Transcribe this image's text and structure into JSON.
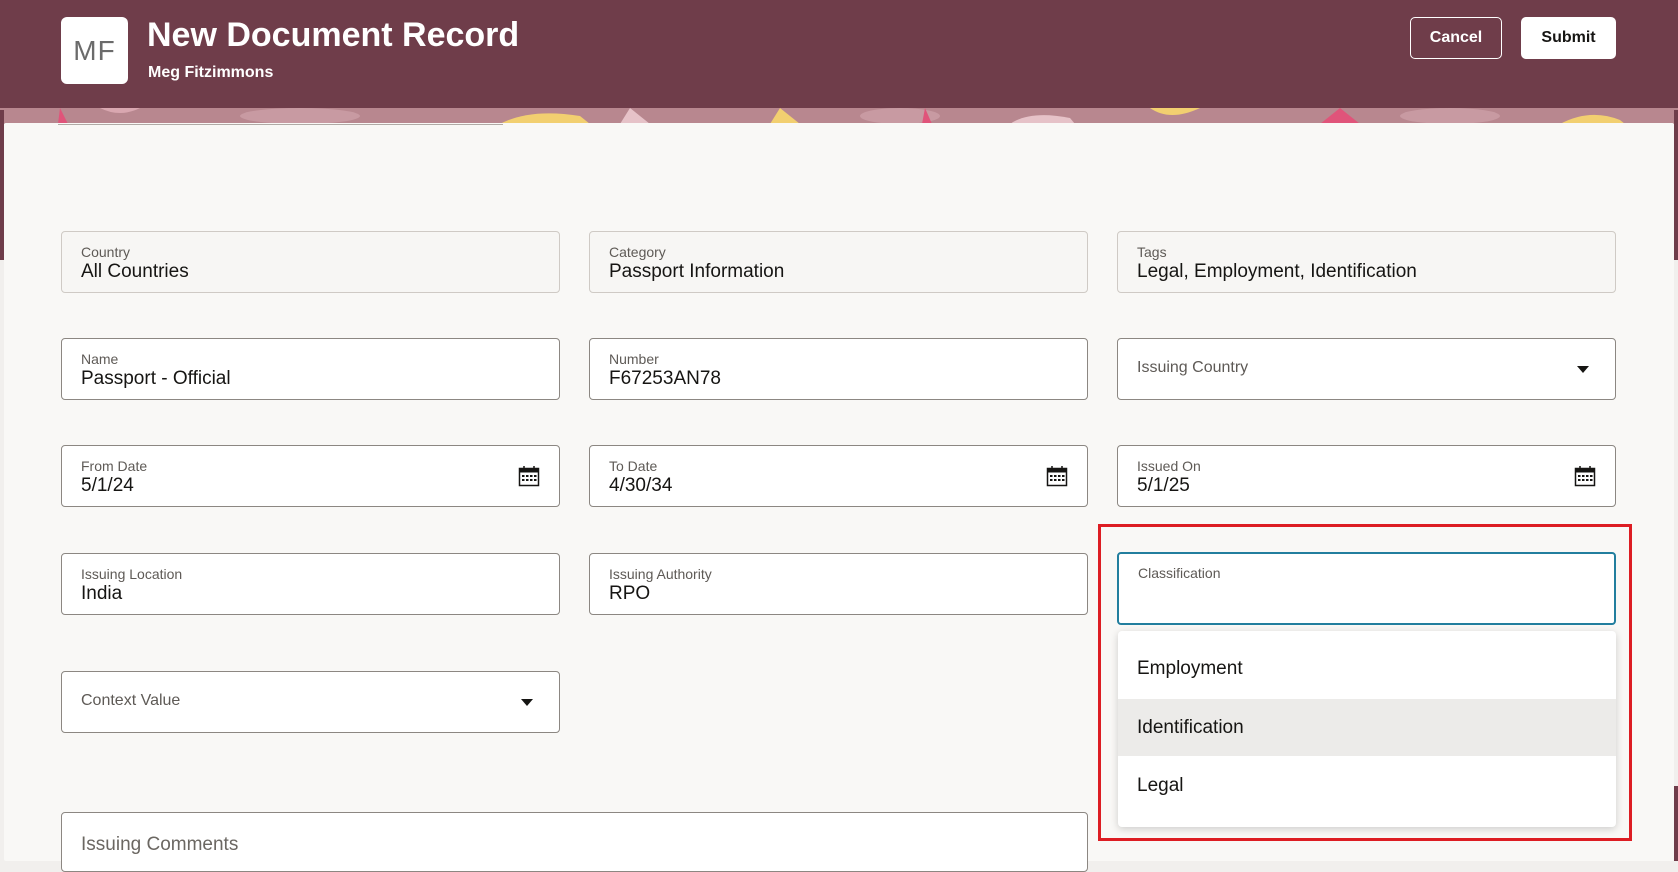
{
  "header": {
    "avatar_initials": "MF",
    "title": "New Document Record",
    "subtitle": "Meg Fitzimmons",
    "cancel_label": "Cancel",
    "submit_label": "Submit"
  },
  "colors": {
    "brand": "#6f3d4a",
    "focus": "#227e9e",
    "highlight_box": "#dd1d23"
  },
  "form": {
    "country": {
      "label": "Country",
      "value": "All Countries"
    },
    "category": {
      "label": "Category",
      "value": "Passport Information"
    },
    "tags": {
      "label": "Tags",
      "value": "Legal, Employment, Identification"
    },
    "name": {
      "label": "Name",
      "value": "Passport - Official"
    },
    "number": {
      "label": "Number",
      "value": "F67253AN78"
    },
    "issuing_country": {
      "placeholder": "Issuing Country"
    },
    "from_date": {
      "label": "From Date",
      "value": "5/1/24"
    },
    "to_date": {
      "label": "To Date",
      "value": "4/30/34"
    },
    "issued_on": {
      "label": "Issued On",
      "value": "5/1/25"
    },
    "issuing_location": {
      "label": "Issuing Location",
      "value": "India"
    },
    "issuing_authority": {
      "label": "Issuing Authority",
      "value": "RPO"
    },
    "classification": {
      "label": "Classification",
      "value": ""
    },
    "context_value": {
      "placeholder": "Context Value"
    },
    "issuing_comments": {
      "placeholder": "Issuing Comments"
    }
  },
  "classification_options": [
    {
      "label": "Employment"
    },
    {
      "label": "Identification",
      "highlighted": true
    },
    {
      "label": "Legal"
    }
  ],
  "icons": {
    "calendar": "calendar-icon",
    "dropdown": "chevron-down-icon"
  }
}
